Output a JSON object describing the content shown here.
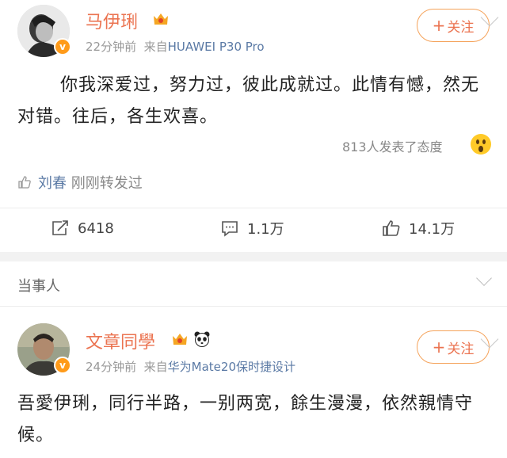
{
  "post1": {
    "author": "马伊琍",
    "time": "22分钟前",
    "source_prefix": "来自",
    "source": "HUAWEI P30 Pro",
    "follow_label": "关注",
    "content": "你我深爱过，努力过，彼此成就过。此情有憾，然无对错。往后，各生欢喜。",
    "attitude_text": "813人发表了态度",
    "repost_user": "刘春",
    "repost_text": "刚刚转发过",
    "actions": {
      "share_count": "6418",
      "comment_count": "1.1万",
      "like_count": "14.1万"
    }
  },
  "section": {
    "title": "当事人"
  },
  "post2": {
    "author": "文章同學",
    "time": "24分钟前",
    "source_prefix": "来自",
    "source": "华为Mate20保时捷设计",
    "follow_label": "关注",
    "content": "吾愛伊琍，同行半路，一别两宽，餘生漫漫，依然親情守候。"
  },
  "colors": {
    "accent": "#eb7350",
    "link": "#5b7aa5",
    "verified_badge": "#ff9b1a",
    "meta": "#999999"
  },
  "icons": {
    "verified": "v",
    "crown": "crown-icon",
    "panda": "panda-icon"
  }
}
